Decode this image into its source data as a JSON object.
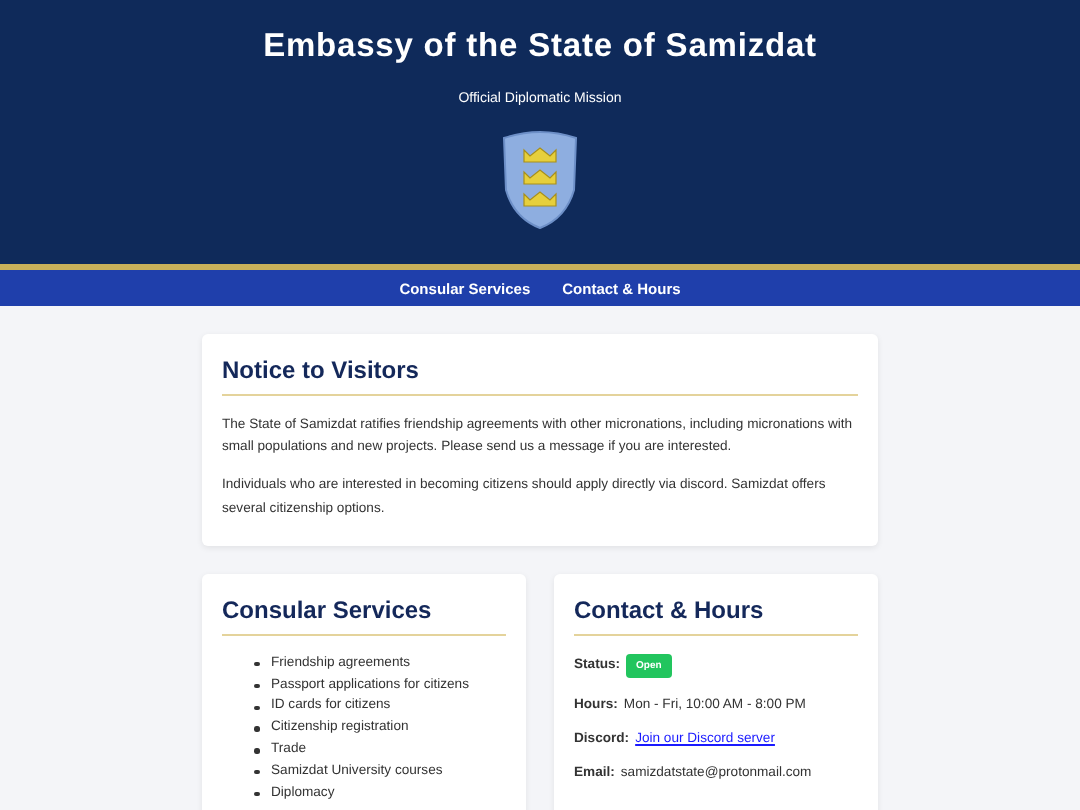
{
  "header": {
    "title": "Embassy of the State of Samizdat",
    "subtitle": "Official Diplomatic Mission"
  },
  "nav": {
    "links": [
      "Consular Services",
      "Contact & Hours"
    ]
  },
  "notice": {
    "title": "Notice to Visitors",
    "paragraphs": [
      "The State of Samizdat ratifies friendship agreements with other micronations, including micronations with small populations and new projects. Please send us a message if you are interested.",
      "Individuals who are interested in becoming citizens should apply directly via discord. Samizdat offers several citizenship options."
    ]
  },
  "services": {
    "title": "Consular Services",
    "items": [
      "Friendship agreements",
      "Passport applications for citizens",
      "ID cards for citizens",
      "Citizenship registration",
      "Trade",
      "Samizdat University courses",
      "Diplomacy"
    ]
  },
  "contact": {
    "title": "Contact & Hours",
    "rows": [
      {
        "kind": "badge",
        "label": "Status:",
        "value": "Open",
        "color": "#22c55e"
      },
      {
        "kind": "text",
        "label": "Hours:",
        "value": "Mon - Fri, 10:00 AM - 8:00 PM"
      },
      {
        "kind": "link",
        "label": "Discord:",
        "value": "Join our Discord server"
      },
      {
        "kind": "text",
        "label": "Email:",
        "value": "samizdatstate@protonmail.com"
      }
    ]
  }
}
